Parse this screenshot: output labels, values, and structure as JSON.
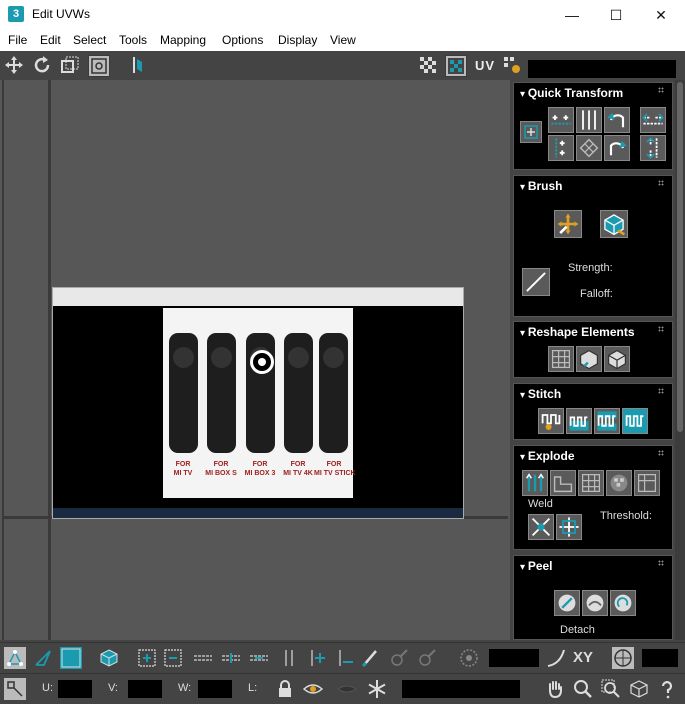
{
  "window": {
    "title": "Edit UVWs",
    "app_icon_text": "3",
    "minimize": "—",
    "maximize": "☐",
    "close": "✕"
  },
  "menu": {
    "items": [
      "File",
      "Edit",
      "Select",
      "Tools",
      "Mapping",
      "Options",
      "Display",
      "View"
    ]
  },
  "toolbar": {
    "uv_label": "UV"
  },
  "texture": {
    "captions": [
      "FOR\nMI TV",
      "FOR\nMI BOX S",
      "FOR\nMI BOX 3",
      "FOR\nMI TV 4K",
      "FOR\nMI TV STICK"
    ]
  },
  "panels": {
    "quick_transform": {
      "title": "Quick Transform"
    },
    "brush": {
      "title": "Brush",
      "strength_label": "Strength:",
      "falloff_label": "Falloff:"
    },
    "reshape": {
      "title": "Reshape Elements"
    },
    "stitch": {
      "title": "Stitch"
    },
    "explode": {
      "title": "Explode",
      "weld_label": "Weld",
      "threshold_label": "Threshold:"
    },
    "peel": {
      "title": "Peel",
      "detach_label": "Detach"
    }
  },
  "bottom": {
    "xy_label": "XY",
    "u_label": "U:",
    "v_label": "V:",
    "w_label": "W:",
    "l_label": "L:"
  },
  "colors": {
    "accent": "#1a9bb0",
    "panel_bg": "#000000",
    "chrome": "#444444"
  }
}
